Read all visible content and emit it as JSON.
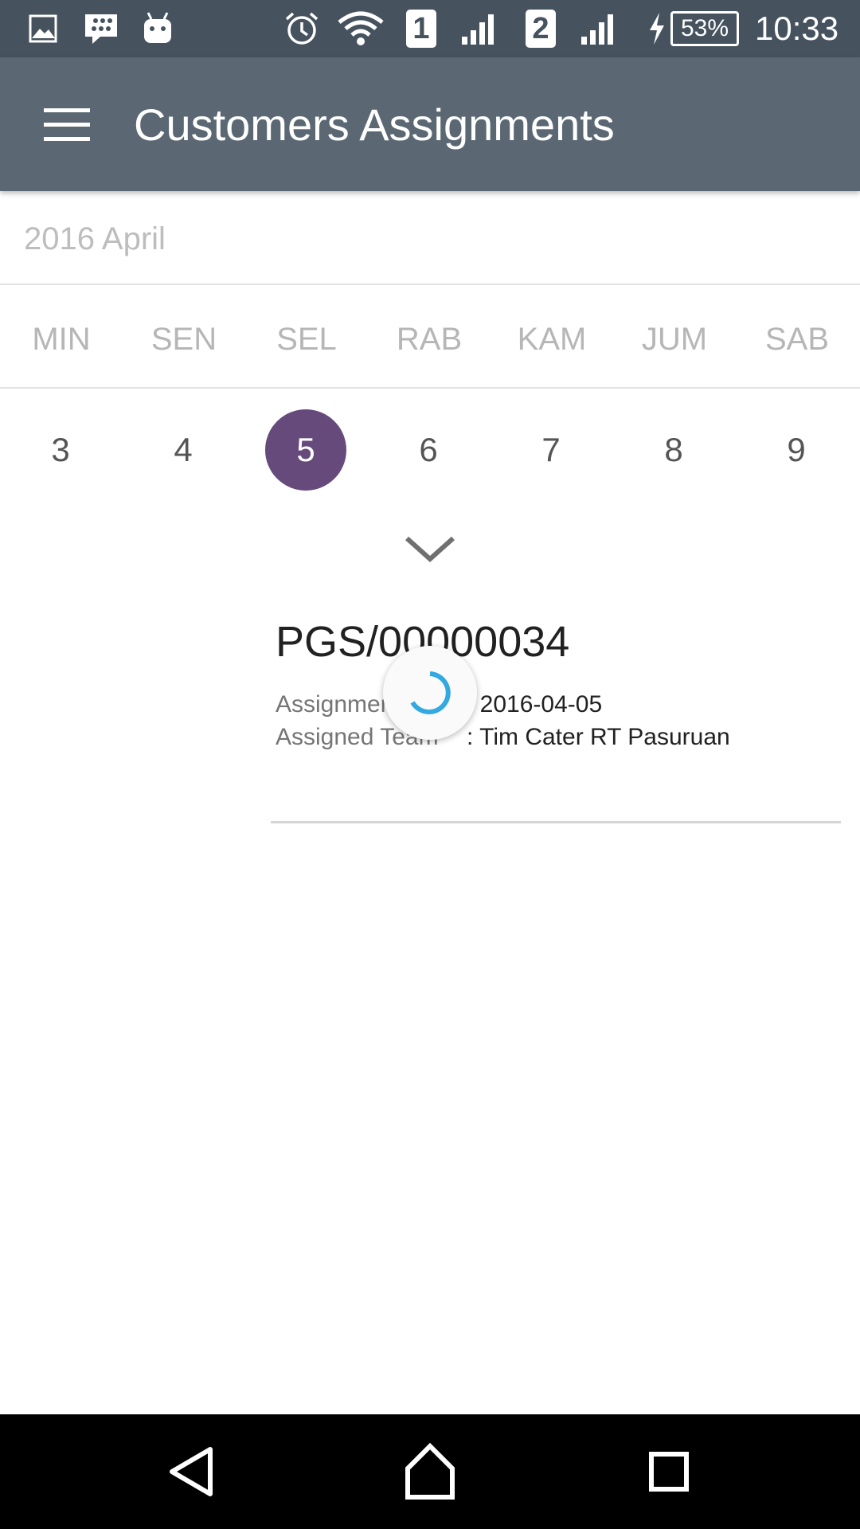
{
  "status_bar": {
    "sim1_label": "1",
    "sim2_label": "2",
    "battery": "53%",
    "time": "10:33",
    "icons": [
      "gallery-icon",
      "bbm-icon",
      "android-icon",
      "alarm-icon",
      "wifi-icon",
      "signal-icon",
      "signal-icon",
      "charging-icon",
      "battery-icon"
    ]
  },
  "app_bar": {
    "title": "Customers Assignments",
    "background": "#5b6874"
  },
  "calendar": {
    "month_label": "2016 April",
    "weekdays": [
      "MIN",
      "SEN",
      "SEL",
      "RAB",
      "KAM",
      "JUM",
      "SAB"
    ],
    "dates": [
      "3",
      "4",
      "5",
      "6",
      "7",
      "8",
      "9"
    ],
    "selected_date": "5",
    "selected_color": "#674a7c"
  },
  "assignment": {
    "code": "PGS/00000034",
    "fields": [
      {
        "label": "Assignment Date",
        "value": ": 2016-04-05"
      },
      {
        "label": "Assigned Team",
        "value": ": Tim Cater RT Pasuruan"
      }
    ]
  },
  "loading": {
    "spinner_color": "#33a9e0"
  },
  "nav_bar": {
    "buttons": [
      "back-icon",
      "home-icon",
      "recents-icon"
    ]
  }
}
